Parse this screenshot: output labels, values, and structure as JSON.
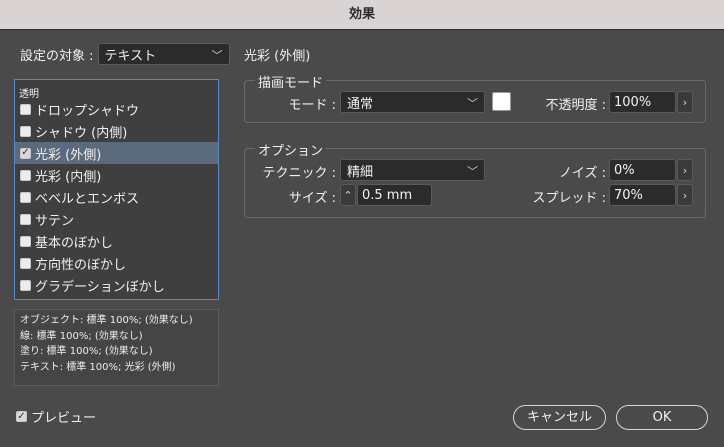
{
  "window": {
    "title": "効果"
  },
  "target": {
    "label": "設定の対象 :",
    "value": "テキスト"
  },
  "section_heading": "光彩 (外側)",
  "effects_list": {
    "title": "透明",
    "items": [
      {
        "label": "ドロップシャドウ",
        "checked": false,
        "selected": false
      },
      {
        "label": "シャドウ (内側)",
        "checked": false,
        "selected": false
      },
      {
        "label": "光彩 (外側)",
        "checked": true,
        "selected": true
      },
      {
        "label": "光彩 (内側)",
        "checked": false,
        "selected": false
      },
      {
        "label": "ベベルとエンボス",
        "checked": false,
        "selected": false
      },
      {
        "label": "サテン",
        "checked": false,
        "selected": false
      },
      {
        "label": "基本のぼかし",
        "checked": false,
        "selected": false
      },
      {
        "label": "方向性のぼかし",
        "checked": false,
        "selected": false
      },
      {
        "label": "グラデーションぼかし",
        "checked": false,
        "selected": false
      }
    ]
  },
  "summary": [
    "オブジェクト: 標準 100%; (効果なし)",
    "線: 標準 100%; (効果なし)",
    "塗り: 標準 100%; (効果なし)",
    "テキスト: 標準 100%; 光彩 (外側)"
  ],
  "blend": {
    "title": "描画モード",
    "mode_label": "モード :",
    "mode_value": "通常",
    "swatch_color": "#ffffff",
    "opacity_label": "不透明度 :",
    "opacity_value": "100%"
  },
  "options": {
    "title": "オプション",
    "technique_label": "テクニック :",
    "technique_value": "精細",
    "noise_label": "ノイズ :",
    "noise_value": "0%",
    "size_label": "サイズ :",
    "size_value": "0.5 mm",
    "spread_label": "スプレッド :",
    "spread_value": "70%"
  },
  "preview": {
    "label": "プレビュー",
    "checked": true
  },
  "buttons": {
    "cancel": "キャンセル",
    "ok": "OK"
  },
  "icons": {
    "dropdown": "chevron-down-icon",
    "more": "chevron-right-icon",
    "stepper": "up-down-stepper-icon",
    "check": "checkmark-icon"
  }
}
